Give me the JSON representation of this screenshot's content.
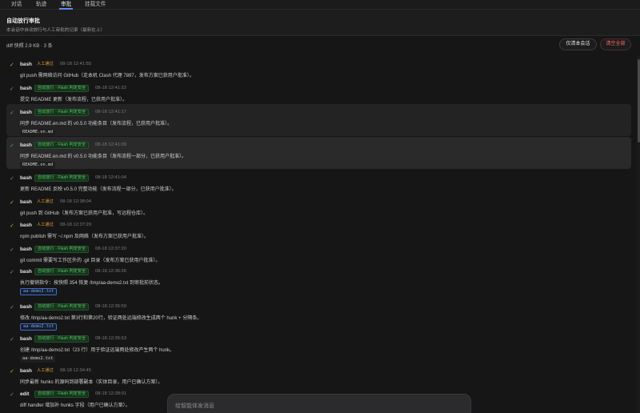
{
  "tabs": [
    "对话",
    "轨迹",
    "审批",
    "挂载文件"
  ],
  "active_tab": "审批",
  "header": {
    "title": "自动放行审批",
    "subtitle": "本会话中自动放行与人工审批的记录（最新在上）"
  },
  "toolbar": {
    "diff_info": "diff 快照 2.9 KB · 3 条",
    "session_only_label": "仅清本会话",
    "clear_all_label": "清空全部"
  },
  "colors": {
    "accent": "#5b8def",
    "auto_green": "#57c466",
    "manual_orange": "#e8a13a",
    "danger": "#ff6b6b"
  },
  "entries": [
    {
      "tool": "bash",
      "kind": "manual",
      "badge": "人工通过",
      "time": "08-18 12:41:55",
      "desc": "git push 需网络访问 GitHub（走本机 Clash 代理 7897，发布方案已获用户批准）。",
      "file": "",
      "file_style": ""
    },
    {
      "tool": "bash",
      "kind": "auto",
      "badge": "自动放行 · Flash 判定安全",
      "time": "08-18 12:41:22",
      "desc": "提交 README 更新（发布流程，已获用户批准）。",
      "file": "",
      "file_style": ""
    },
    {
      "tool": "bash",
      "kind": "auto",
      "badge": "自动放行 · Flash 判定安全",
      "time": "08-18 12:41:17",
      "desc": "同步 README.en.md 的 v0.5.0 功能条目（发布流程，已获用户批准）。",
      "file": "README.en.md",
      "file_style": "plain"
    },
    {
      "tool": "bash",
      "kind": "auto",
      "badge": "自动放行 · Flash 判定安全",
      "time": "08-18 12:41:09",
      "desc": "同步 README.en.md 的 v0.5.0 功能条目（发布流程一部分，已获用户批准）。",
      "file": "README.en.md",
      "file_style": "plain"
    },
    {
      "tool": "bash",
      "kind": "auto",
      "badge": "自动放行 · Flash 判定安全",
      "time": "08-18 12:41:04",
      "desc": "更新 README 反映 v0.5.0 完整功能（发布流程一部分，已获用户批准）。",
      "file": "",
      "file_style": ""
    },
    {
      "tool": "bash",
      "kind": "manual",
      "badge": "人工通过",
      "time": "08-18 12:38:04",
      "desc": "git push 到 GitHub（发布方案已获用户批准，写远程仓库）。",
      "file": "",
      "file_style": ""
    },
    {
      "tool": "bash",
      "kind": "manual",
      "badge": "人工通过",
      "time": "08-18 12:37:29",
      "desc": "npm publish 需写 ~/.npm 及网络（发布方案已获用户批准）。",
      "file": "",
      "file_style": ""
    },
    {
      "tool": "bash",
      "kind": "auto",
      "badge": "自动放行 · Flash 判定安全",
      "time": "08-18 12:37:20",
      "desc": "git commit 需要写工作区外的 .git 目录（发布方案已获用户批准）。",
      "file": "",
      "file_style": ""
    },
    {
      "tool": "bash",
      "kind": "auto",
      "badge": "自动放行 · Flash 判定安全",
      "time": "08-18 12:36:26",
      "desc": "执行撤销指令：按快照 354 恢复 /tmp/aa-demo2.txt 到审批前状态。",
      "file": "aa-demo2.txt",
      "file_style": "boxed"
    },
    {
      "tool": "bash",
      "kind": "auto",
      "badge": "自动放行 · Flash 判定安全",
      "time": "08-18 12:35:59",
      "desc": "修改 /tmp/aa-demo2.txt 第3行和第20行，验证两处远端修改生成两个 hunk + 分隔条。",
      "file": "aa-demo2.txt",
      "file_style": "boxed"
    },
    {
      "tool": "bash",
      "kind": "auto",
      "badge": "自动放行 · Flash 判定安全",
      "time": "08-18 12:35:53",
      "desc": "创建 /tmp/aa-demo2.txt（23 行）用于验证远端两处修改产生两个 hunk。",
      "file": "aa-demo2.txt",
      "file_style": "plain"
    },
    {
      "tool": "bash",
      "kind": "manual",
      "badge": "人工通过",
      "time": "08-18 12:34:45",
      "desc": "同步最新 hunks 的源码到部署副本（实体目录，用户已确认方案）。",
      "file": "",
      "file_style": ""
    },
    {
      "tool": "edit",
      "kind": "auto",
      "badge": "自动放行 · Flash 判定安全",
      "time": "08-18 12:28:01",
      "desc": "diff handler 增加补 hunks 字段（用户已确认方案）。",
      "file": "",
      "file_style": ""
    }
  ],
  "composer": {
    "placeholder": "给智能体发消息"
  }
}
